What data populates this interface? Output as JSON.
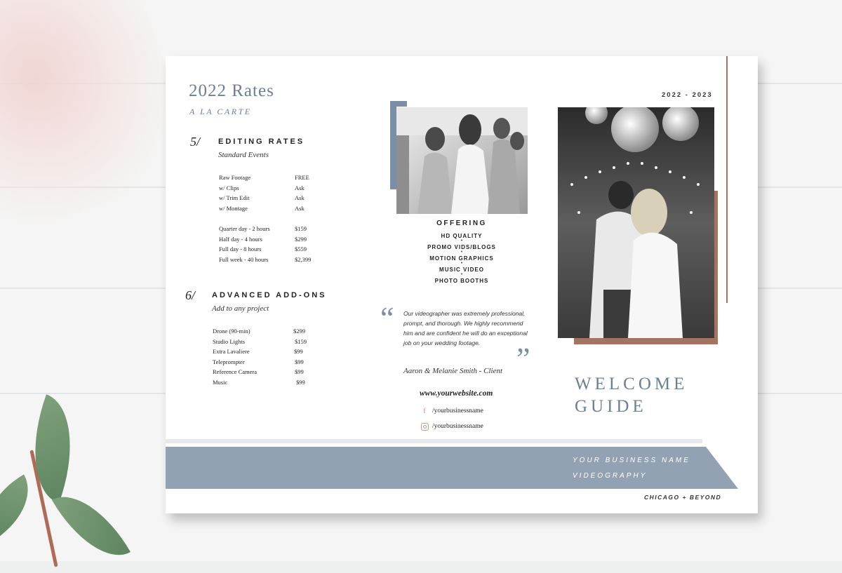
{
  "rates_panel": {
    "title": "2022 Rates",
    "subtitle": "A LA CARTE",
    "sections": [
      {
        "number": "5/",
        "heading": "EDITING RATES",
        "subheading": "Standard Events",
        "groups": [
          [
            {
              "label": "Raw Footage",
              "price": "FREE"
            },
            {
              "label": "w/ Clips",
              "price": "Ask"
            },
            {
              "label": "w/ Trim Edit",
              "price": "Ask"
            },
            {
              "label": "w/ Montage",
              "price": "Ask"
            }
          ],
          [
            {
              "label": "Quarter day - 2 hours",
              "price": "$159"
            },
            {
              "label": "Half day - 4 hours",
              "price": "$299"
            },
            {
              "label": "Full day - 8 hours",
              "price": "$559"
            },
            {
              "label": "Full week - 40 hours",
              "price": "$2,399"
            }
          ]
        ]
      },
      {
        "number": "6/",
        "heading": "ADVANCED ADD-ONS",
        "subheading": "Add to any project",
        "groups": [
          [
            {
              "label": "Drone (90-min)",
              "price": "$299"
            },
            {
              "label": "Studio Lights",
              "price": "$159"
            },
            {
              "label": "Extra Lavaliere",
              "price": "$99"
            },
            {
              "label": "Teleprompter",
              "price": "$99"
            },
            {
              "label": "Reference Camera",
              "price": "$99"
            },
            {
              "label": "Music",
              "price": "$99"
            }
          ]
        ]
      }
    ]
  },
  "middle_panel": {
    "offering_heading": "OFFERING",
    "offerings": [
      "HD QUALITY",
      "PROMO VIDS/BLOGS",
      "MOTION GRAPHICS",
      "MUSIC VIDEO",
      "PHOTO BOOTHS"
    ],
    "offering_separator": "•",
    "quote_open": "“",
    "quote_close": "”",
    "testimonial": "Our videographer was extremely professional, prompt, and thorough. We highly recommend him and are confident he will do an exceptional job on your wedding footage.",
    "testimonial_author": "Aaron & Melanie Smith - Client",
    "website": "www.yourwebsite.com",
    "facebook_handle": "/yourbusinessname",
    "instagram_handle": "/yourbusinessname",
    "facebook_icon_glyph": "f"
  },
  "cover_panel": {
    "year_range": "2022 - 2023",
    "welcome_line1": "WELCOME",
    "welcome_line2": "GUIDE",
    "business_name": "YOUR BUSINESS NAME",
    "business_type": "VIDEOGRAPHY",
    "location": "CHICAGO + BEYOND"
  },
  "colors": {
    "accent_blue": "#7b8ea5",
    "accent_copper": "#a37462",
    "footer_bar": "#93a2b2",
    "title_text": "#6b7f97"
  },
  "icons": [
    "facebook-icon",
    "instagram-icon"
  ]
}
